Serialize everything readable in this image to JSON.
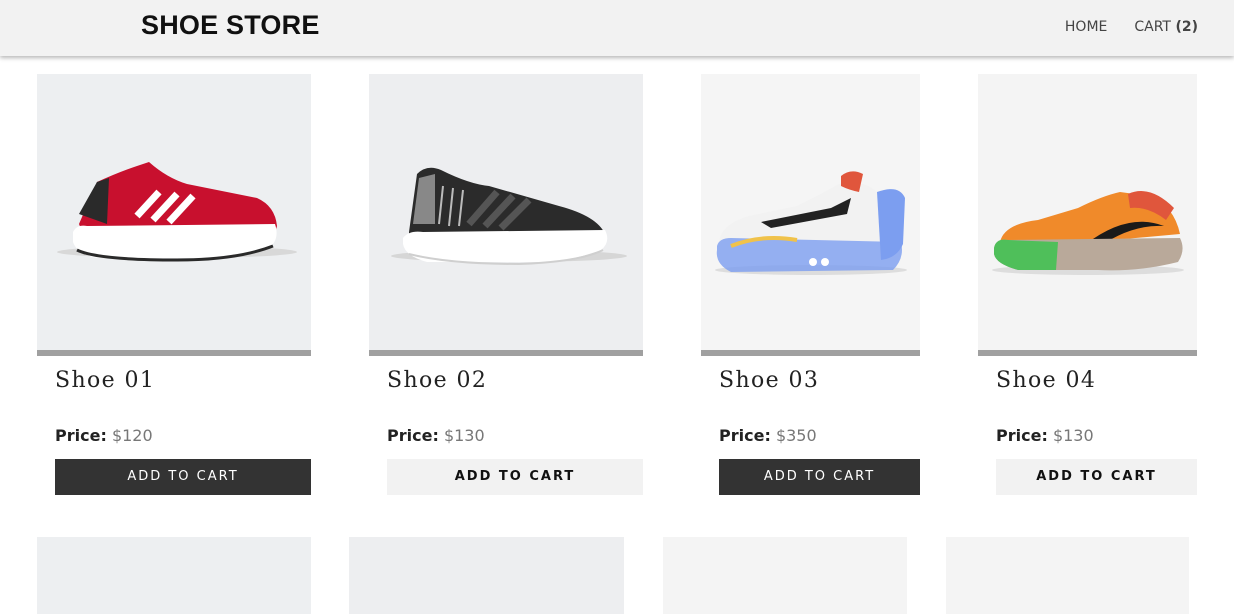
{
  "header": {
    "brand": "SHOE STORE",
    "nav": {
      "home": "HOME",
      "cart_label": "CART",
      "cart_count": "(2)"
    }
  },
  "products": [
    {
      "name": "Shoe 01",
      "price_label": "Price:",
      "price": "$120",
      "button": "ADD TO CART",
      "bg": "#edeff1",
      "button_style": "dark",
      "shoe_colors": [
        "#c8102e",
        "#ffffff",
        "#2a2a2a"
      ]
    },
    {
      "name": "Shoe 02",
      "price_label": "Price:",
      "price": "$130",
      "button": "ADD TO CART",
      "bg": "#edeef0",
      "button_style": "light",
      "shoe_colors": [
        "#2b2b2b",
        "#ffffff",
        "#777777"
      ]
    },
    {
      "name": "Shoe 03",
      "price_label": "Price:",
      "price": "$350",
      "button": "ADD TO CART",
      "bg": "#f5f5f5",
      "button_style": "dark",
      "shoe_colors": [
        "#f2f2f2",
        "#7c9ef0",
        "#e0563c"
      ]
    },
    {
      "name": "Shoe 04",
      "price_label": "Price:",
      "price": "$130",
      "button": "ADD TO CART",
      "bg": "#f4f4f4",
      "button_style": "light",
      "shoe_colors": [
        "#f08a2a",
        "#4fbf5a",
        "#1a1a1a"
      ]
    }
  ],
  "placeholders": [
    {
      "bg": "#edeff1"
    },
    {
      "bg": "#edeef0"
    },
    {
      "bg": "#f4f4f4"
    },
    {
      "bg": "#f4f4f4"
    }
  ]
}
